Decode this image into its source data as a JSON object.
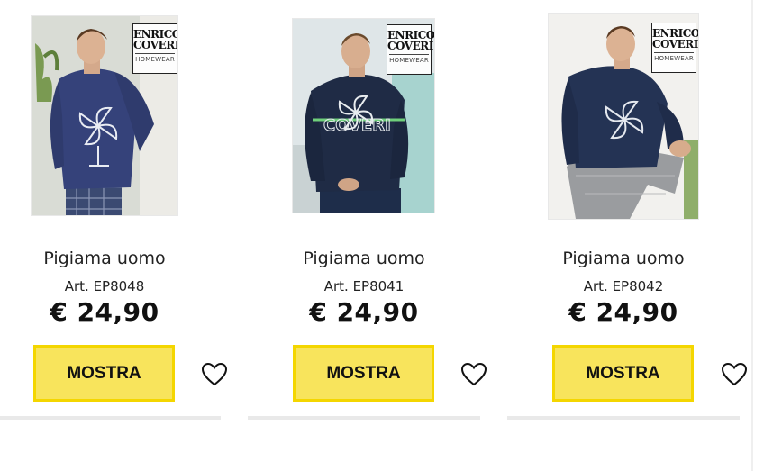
{
  "products": [
    {
      "title": "Pigiama uomo",
      "code": "Art. EP8048",
      "price": "€ 24,90",
      "button_label": "MOSTRA",
      "brand_line1": "ENRICO",
      "brand_line2": "COVERI",
      "brand_sub": "HOMEWEAR"
    },
    {
      "title": "Pigiama uomo",
      "code": "Art. EP8041",
      "price": "€ 24,90",
      "button_label": "MOSTRA",
      "brand_line1": "ENRICO",
      "brand_line2": "COVERI",
      "brand_sub": "HOMEWEAR"
    },
    {
      "title": "Pigiama uomo",
      "code": "Art. EP8042",
      "price": "€ 24,90",
      "button_label": "MOSTRA",
      "brand_line1": "ENRICO",
      "brand_line2": "COVERI",
      "brand_sub": "HOMEWEAR"
    }
  ],
  "icons": {
    "wishlist": "heart-outline-icon"
  },
  "colors": {
    "button_fill": "#f8e45c",
    "button_border": "#f4d600",
    "divider": "#e9e9e9"
  }
}
